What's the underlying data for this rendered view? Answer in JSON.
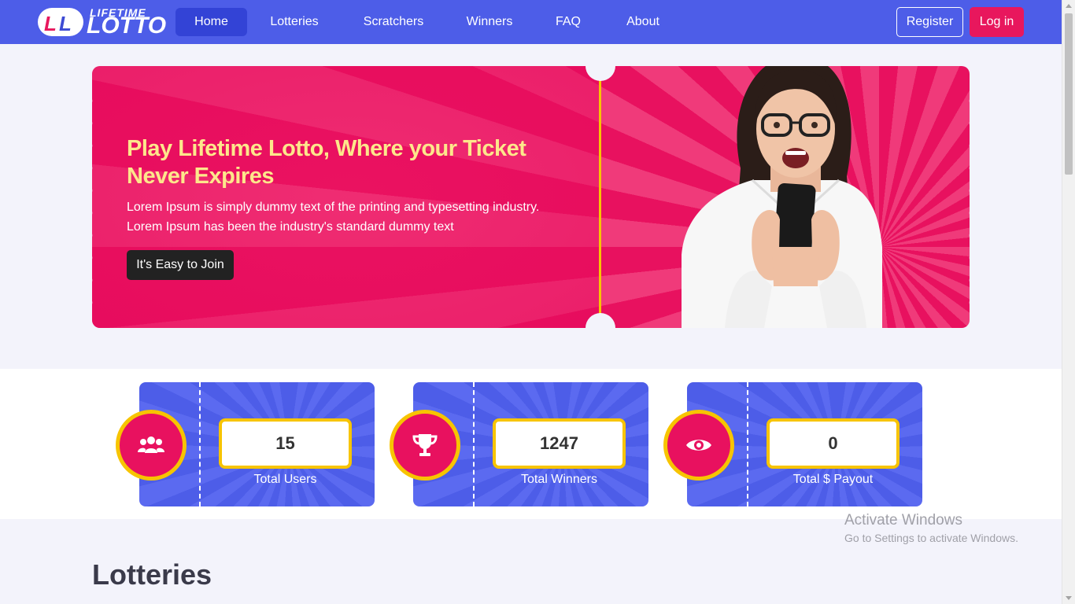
{
  "header": {
    "logo": {
      "top": "LIFETIME",
      "main": "LOTTO",
      "badge": "LL"
    },
    "nav": [
      {
        "label": "Home",
        "active": true
      },
      {
        "label": "Lotteries",
        "active": false
      },
      {
        "label": "Scratchers",
        "active": false
      },
      {
        "label": "Winners",
        "active": false
      },
      {
        "label": "FAQ",
        "active": false
      },
      {
        "label": "About",
        "active": false
      }
    ],
    "register_label": "Register",
    "login_label": "Log in"
  },
  "hero": {
    "title": "Play Lifetime Lotto, Where your Ticket Never Expires",
    "text": "Lorem Ipsum is simply dummy text of the printing and typesetting industry. Lorem Ipsum has been the industry's standard dummy text",
    "cta_label": "It's Easy to Join"
  },
  "stats": [
    {
      "value": "15",
      "label": "Total Users",
      "icon": "users-icon"
    },
    {
      "value": "1247",
      "label": "Total Winners",
      "icon": "trophy-icon"
    },
    {
      "value": "0",
      "label": "Total $ Payout",
      "icon": "eye-icon"
    }
  ],
  "lotteries": {
    "title": "Lotteries"
  },
  "watermark": {
    "line1": "Activate Windows",
    "line2": "Go to Settings to activate Windows."
  },
  "colors": {
    "nav": "#4d5de8",
    "accent": "#e8175d",
    "gold": "#f7c400",
    "hero_title": "#fde78b"
  }
}
